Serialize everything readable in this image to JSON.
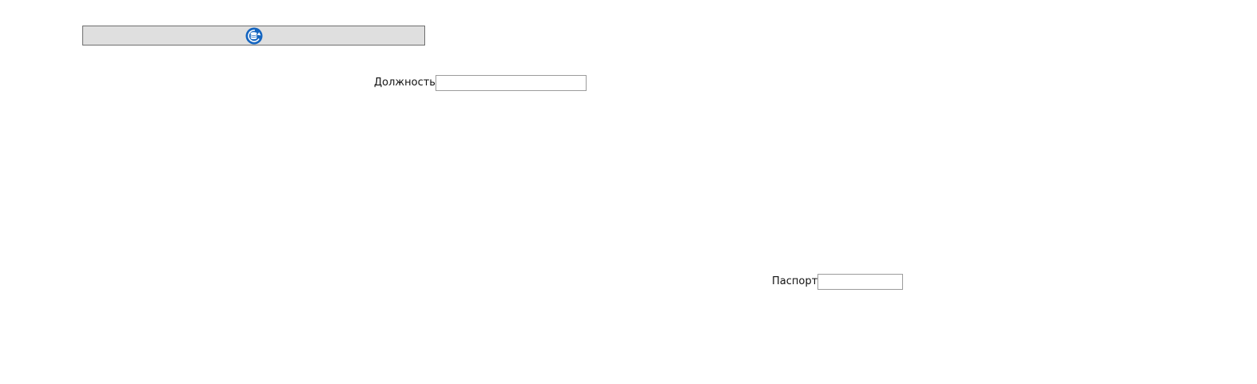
{
  "toolbar": {
    "icon": "database-refresh-icon",
    "icon_color": "#1565c0"
  },
  "form": {
    "position": {
      "label": "Должность",
      "value": "",
      "placeholder": ""
    },
    "passport": {
      "label": "Паспорт",
      "value": "",
      "placeholder": ""
    }
  }
}
